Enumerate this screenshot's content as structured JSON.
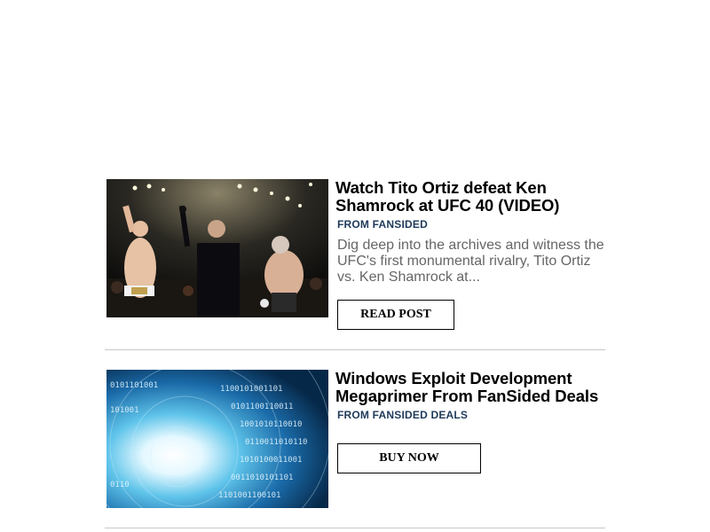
{
  "feed": {
    "items": [
      {
        "title": "Watch Tito Ortiz defeat Ken Shamrock at UFC 40 (VIDEO)",
        "source": "FROM FANSIDED",
        "description": "Dig deep into the archives and witness the UFC's first monumental rivalry, Tito Ortiz vs. Ken Shamrock at...",
        "cta_label": "READ POST",
        "image_icon": "mma-fight-photo"
      },
      {
        "title": "Windows Exploit Development Megaprimer From FanSided Deals",
        "source": "FROM FANSIDED DEALS",
        "description": "",
        "cta_label": "BUY NOW",
        "image_icon": "binary-tunnel-image"
      }
    ]
  },
  "colors": {
    "source_text": "#1f3a5a",
    "description_text": "#666666",
    "divider": "#c8c8c8"
  }
}
